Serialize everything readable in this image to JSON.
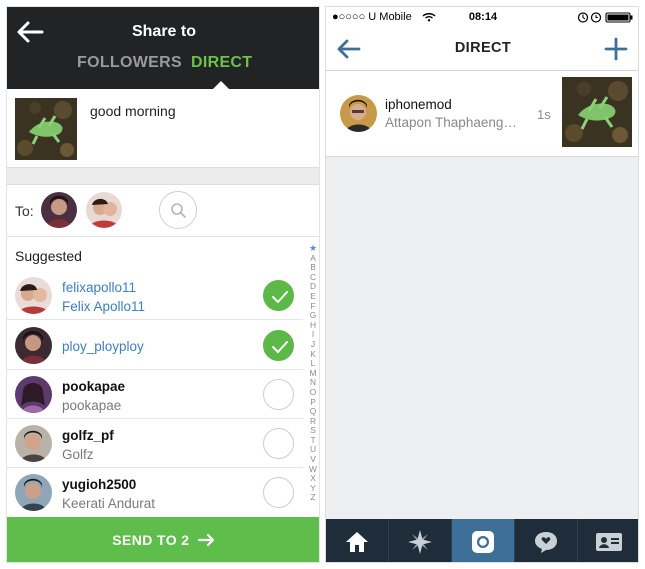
{
  "left": {
    "header": {
      "title": "Share to",
      "tabs": [
        "FOLLOWERS",
        "DIRECT"
      ],
      "active_tab": "DIRECT"
    },
    "post": {
      "caption": "good morning"
    },
    "to": {
      "label": "To:"
    },
    "suggested": {
      "label": "Suggested",
      "contacts": [
        {
          "username": "felixapollo11",
          "name": "Felix Apollo11",
          "selected": true
        },
        {
          "username": "ploy_ployploy",
          "name": "",
          "selected": true
        },
        {
          "username": "pookapae",
          "name": "pookapae",
          "selected": false
        },
        {
          "username": "golfz_pf",
          "name": "Golfz",
          "selected": false
        },
        {
          "username": "yugioh2500",
          "name": "Keerati Andurat",
          "selected": false
        }
      ]
    },
    "alpha_index": [
      "★",
      "A",
      "B",
      "C",
      "D",
      "E",
      "F",
      "G",
      "H",
      "I",
      "J",
      "K",
      "L",
      "M",
      "N",
      "O",
      "P",
      "Q",
      "R",
      "S",
      "T",
      "U",
      "V",
      "W",
      "X",
      "Y",
      "Z"
    ],
    "send_label": "SEND TO 2"
  },
  "right": {
    "status": {
      "carrier": "●○○○○ U Mobile",
      "time": "08:14"
    },
    "header": {
      "title": "DIRECT"
    },
    "thread": {
      "username": "iphonemod",
      "subtitle": "Attapon Thaphaeng…",
      "time": "1s"
    },
    "tabbar": {
      "items": [
        "home-icon",
        "explore-icon",
        "camera-icon",
        "activity-icon",
        "profile-icon"
      ],
      "active": "camera-icon"
    }
  },
  "colors": {
    "accent_green": "#5fbd4c",
    "link_blue": "#3d7fbf",
    "header_dark": "#222325",
    "tabbar_navy": "#1f2d3a",
    "tabbar_active": "#3d6f99"
  }
}
